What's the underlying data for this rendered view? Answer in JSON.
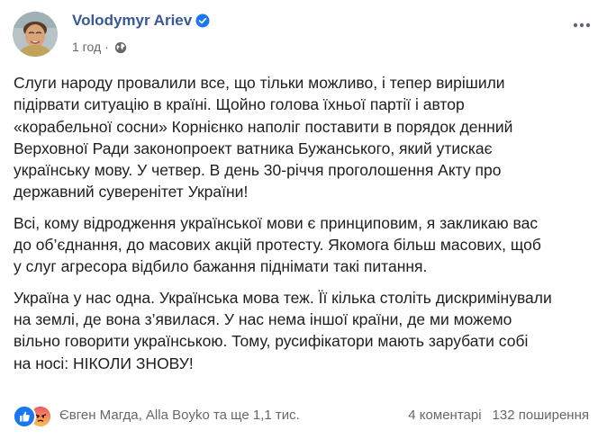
{
  "post": {
    "author": "Volodymyr Ariev",
    "timestamp": "1 год",
    "separator": "·",
    "paragraphs": [
      "Слуги народу провалили все, що тільки можливо, і тепер вирішили\nпідірвати ситуацію в країні. Щойно голова їхньої партії і автор\n«корабельної сосни» Корнієнко наполіг поставити в порядок денний\nВерховної Ради законопроект ватника Бужанського, який утискає\nукраїнську мову. У четвер. В день 30-річчя проголошення Акту про\nдержавний суверенітет України!",
      "Всі, кому відродження української мови є принциповим, я закликаю вас\nдо об’єднання, до масових акцій протесту. Якомога більш масових, щоб\nу слуг агресора відбило бажання піднімати такі питання.",
      "Україна у нас одна. Українська мова теж. Її кілька століть дискримінували\nна землі, де вона з’явилася. У нас нема іншої країни, де ми можемо\nвільно говорити українською. Тому, русифікатори мають зарубати собі\nна носі: НІКОЛИ ЗНОВУ!"
    ]
  },
  "footer": {
    "reactions_text": "Євген Магда, Alla Boyko та ще 1,1 тис.",
    "comments": "4 коментарі",
    "shares": "132 поширення"
  },
  "icons": {
    "verified": "verified-badge-icon",
    "privacy": "globe-icon",
    "more": "more-options-icon",
    "reaction_1": "like-icon",
    "reaction_2": "angry-icon"
  },
  "colors": {
    "author": "#385898",
    "verified": "#1877f2",
    "meta": "#65676b",
    "text": "#1c1e21",
    "like": "#1877f2",
    "angry": "#f25268"
  }
}
